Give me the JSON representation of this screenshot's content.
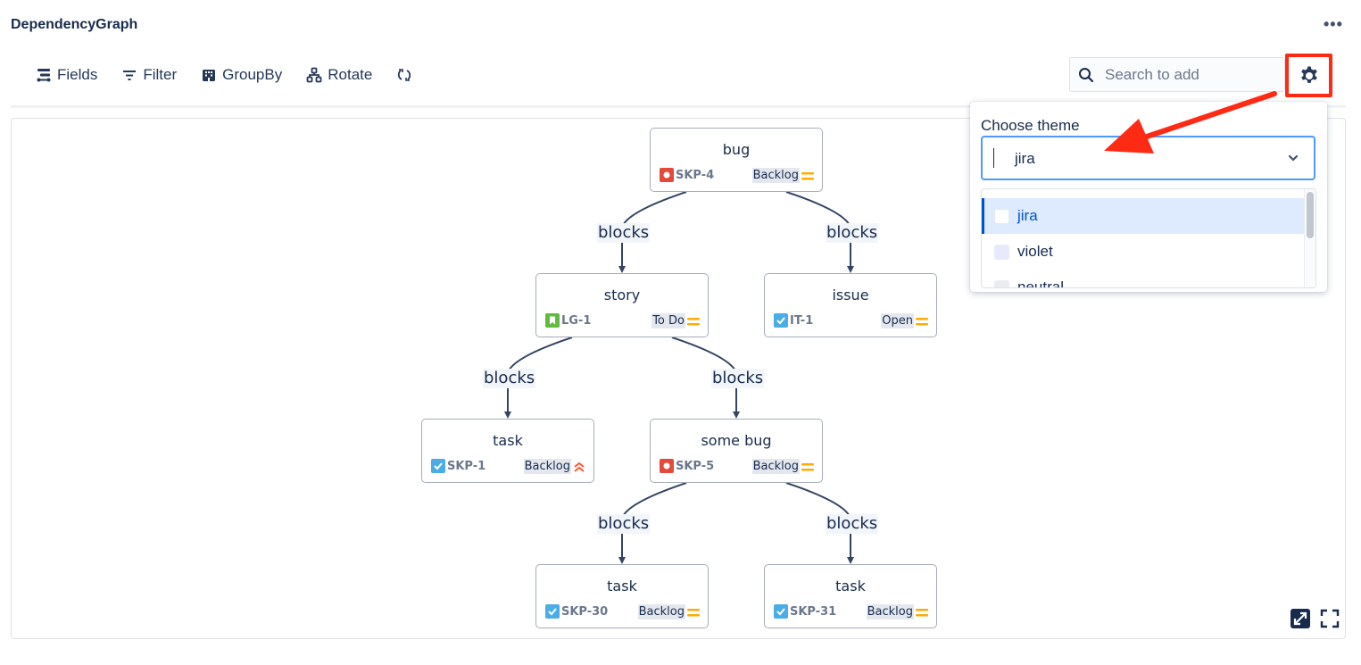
{
  "app": {
    "title": "DependencyGraph",
    "more_label": "•••"
  },
  "toolbar": {
    "fields_label": "Fields",
    "filter_label": "Filter",
    "groupby_label": "GroupBy",
    "rotate_label": "Rotate",
    "search_placeholder": "Search to add",
    "search_value": ""
  },
  "theme_panel": {
    "label": "Choose theme",
    "selected": "jira",
    "options": [
      {
        "label": "jira",
        "swatch": "#ffffff",
        "selected": true
      },
      {
        "label": "violet",
        "swatch": "#e8eafc",
        "selected": false
      },
      {
        "label": "neutral",
        "swatch": "#ebecf0",
        "selected": false
      }
    ]
  },
  "graph": {
    "nodes": [
      {
        "id": "bug",
        "title": "bug",
        "key": "SKP-4",
        "type": "bug",
        "status": "Backlog",
        "priority": "medium"
      },
      {
        "id": "story",
        "title": "story",
        "key": "LG-1",
        "type": "story",
        "status": "To Do",
        "priority": "medium"
      },
      {
        "id": "issue",
        "title": "issue",
        "key": "IT-1",
        "type": "task",
        "status": "Open",
        "priority": "medium"
      },
      {
        "id": "task1",
        "title": "task",
        "key": "SKP-1",
        "type": "task",
        "status": "Backlog",
        "priority": "highest"
      },
      {
        "id": "somebug",
        "title": "some bug",
        "key": "SKP-5",
        "type": "bug",
        "status": "Backlog",
        "priority": "medium"
      },
      {
        "id": "task30",
        "title": "task",
        "key": "SKP-30",
        "type": "task",
        "status": "Backlog",
        "priority": "medium"
      },
      {
        "id": "task31",
        "title": "task",
        "key": "SKP-31",
        "type": "task",
        "status": "Backlog",
        "priority": "medium"
      }
    ],
    "edges": [
      {
        "from": "bug",
        "to": "story",
        "label": "blocks"
      },
      {
        "from": "bug",
        "to": "issue",
        "label": "blocks"
      },
      {
        "from": "story",
        "to": "task1",
        "label": "blocks"
      },
      {
        "from": "story",
        "to": "somebug",
        "label": "blocks"
      },
      {
        "from": "somebug",
        "to": "task30",
        "label": "blocks"
      },
      {
        "from": "somebug",
        "to": "task31",
        "label": "blocks"
      }
    ]
  },
  "colors": {
    "bug": "#e5493a",
    "story": "#63ba3c",
    "task": "#4bade8",
    "priority_medium": "#ffab00",
    "priority_highest": "#ff5630",
    "annotation": "#ff2a13",
    "edge": "#344563"
  }
}
